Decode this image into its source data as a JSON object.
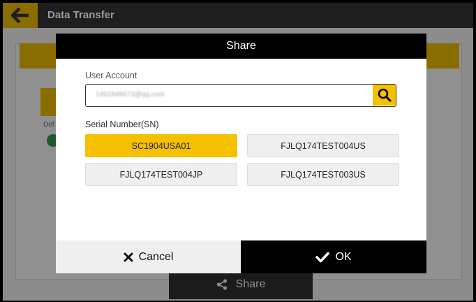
{
  "app": {
    "title": "Data Transfer",
    "bg_default_label": "Def",
    "share_button_label": "Share"
  },
  "dialog": {
    "title": "Share",
    "user_account_label": "User Account",
    "email_value": "1461846673@qq.com",
    "serial_number_label": "Serial Number(SN)",
    "serial_numbers": [
      {
        "label": "SC1904USA01",
        "selected": true
      },
      {
        "label": "FJLQ174TEST004US",
        "selected": false
      },
      {
        "label": "FJLQ174TEST004JP",
        "selected": false
      },
      {
        "label": "FJLQ174TEST003US",
        "selected": false
      }
    ],
    "cancel_label": "Cancel",
    "ok_label": "OK"
  },
  "colors": {
    "accent": "#f5c000",
    "header": "#000000",
    "dim_overlay": "#8c8c8c"
  },
  "icons": {
    "back": "arrow-left-icon",
    "search": "search-icon",
    "cancel": "close-icon",
    "ok": "check-icon",
    "share": "share-icon"
  }
}
